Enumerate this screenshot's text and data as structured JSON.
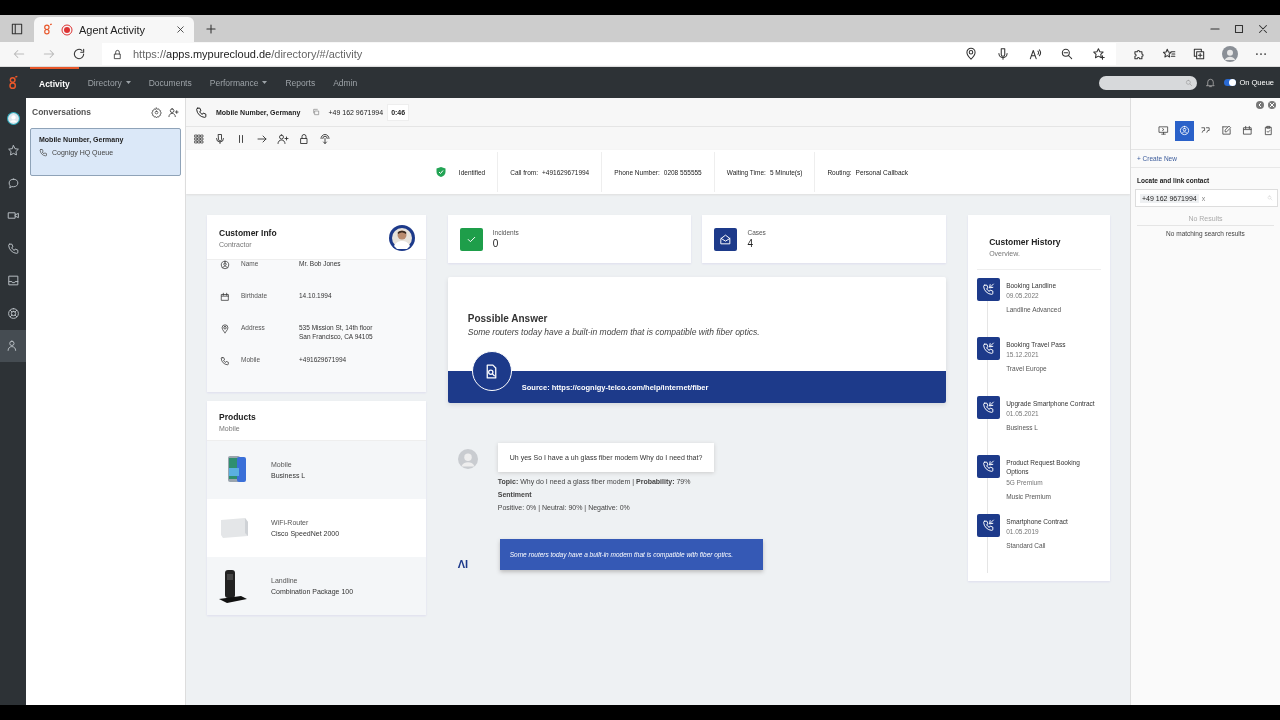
{
  "browser": {
    "tab_title": "Agent Activity",
    "url_scheme": "https://",
    "url_host": "apps.mypurecloud.de",
    "url_path": "/directory/#/activity"
  },
  "nav": {
    "items": [
      {
        "label": "Activity",
        "selected": true,
        "dropdown": false
      },
      {
        "label": "Directory",
        "selected": false,
        "dropdown": true
      },
      {
        "label": "Documents",
        "selected": false,
        "dropdown": false
      },
      {
        "label": "Performance",
        "selected": false,
        "dropdown": true
      },
      {
        "label": "Reports",
        "selected": false,
        "dropdown": false
      },
      {
        "label": "Admin",
        "selected": false,
        "dropdown": false
      }
    ],
    "status": {
      "label": "On Queue",
      "on": true
    }
  },
  "rail": [
    {
      "kind": "avatar",
      "selected": false
    },
    {
      "kind": "star",
      "selected": false
    },
    {
      "kind": "chat",
      "selected": false
    },
    {
      "kind": "video",
      "selected": false
    },
    {
      "kind": "phone",
      "selected": false
    },
    {
      "kind": "inbox",
      "selected": false
    },
    {
      "kind": "support",
      "selected": false
    },
    {
      "kind": "agents",
      "selected": true
    }
  ],
  "conversations": {
    "title": "Conversations",
    "items": [
      {
        "name": "Mobile Number, Germany",
        "queue": "Cognigy HQ Queue",
        "selected": true
      }
    ]
  },
  "call": {
    "name": "Mobile Number, Germany",
    "number": "+49 162 9671994",
    "timer": "0:46"
  },
  "info_strip": {
    "status": "Identified",
    "fields": [
      {
        "label": "Call from:",
        "value": "+491629671994"
      },
      {
        "label": "Phone Number:",
        "value": "0208 555555"
      },
      {
        "label": "Waiting Time:",
        "value": "5 Minute(s)"
      },
      {
        "label": "Routing:",
        "value": "Personal Callback"
      }
    ]
  },
  "customer_info": {
    "title": "Customer Info",
    "subtitle": "Contractor",
    "rows": [
      {
        "kind": "person",
        "label": "Name",
        "lines": [
          "Mr. Bob Jones"
        ]
      },
      {
        "kind": "calendar",
        "label": "Birthdate",
        "lines": [
          "14.10.1994"
        ]
      },
      {
        "kind": "location",
        "label": "Address",
        "lines": [
          "535 Mission St, 14th floor",
          "San Francisco, CA 94105"
        ]
      },
      {
        "kind": "phone",
        "label": "Mobile",
        "lines": [
          "+491629671994"
        ]
      }
    ]
  },
  "products": {
    "title": "Products",
    "subtitle": "Mobile",
    "items": [
      {
        "kind": "mobile",
        "name": "Mobile",
        "plan": "Business L"
      },
      {
        "kind": "router",
        "name": "WiFi-Router",
        "plan": "Cisco SpeedNet 2000"
      },
      {
        "kind": "landline",
        "name": "Landline",
        "plan": "Combination Package 100"
      }
    ]
  },
  "stats": [
    {
      "kind": "check",
      "label": "Incidents",
      "value": "0",
      "color": "#1e9e4a"
    },
    {
      "kind": "mail",
      "label": "Cases",
      "value": "4",
      "color": "#1d3a8a"
    }
  ],
  "answer": {
    "title": "Possible Answer",
    "text": "Some routers today have a built-in modem that is compatible with fiber optics.",
    "source": "Source: https://cognigy-telco.com/help/internet/fiber"
  },
  "transcript": {
    "customer_message": "Uh yes So I have a uh glass fiber modem Why do I need that?",
    "topic_line": "**Topic:** Why do I need a glass fiber modem | **Probability:** 79%",
    "sentiment_title": "Sentiment",
    "sentiment_line": "Positive: 0% | Neutral: 90% | Negative: 0%",
    "bot_label": "ΛI",
    "bot_message": "Some routers today have a built-in modem that is compatible with fiber optics."
  },
  "history": {
    "title": "Customer History",
    "subtitle": "Overview.",
    "items": [
      {
        "title": "Booking Landline",
        "lines": [
          "09.05.2022",
          "Landline Advanced"
        ]
      },
      {
        "title": "Booking Travel Pass",
        "lines": [
          "15.12.2021",
          "Travel Europe"
        ]
      },
      {
        "title": "Upgrade Smartphone Contract",
        "lines": [
          "01.05.2021",
          "Business L"
        ]
      },
      {
        "title": "Product Request Booking Options",
        "lines": [
          "5G Premium",
          "Music Premium"
        ]
      },
      {
        "title": "Smartphone Contract",
        "lines": [
          "01.05.2019",
          "Standard Call"
        ]
      }
    ]
  },
  "right_panel": {
    "tools": [
      {
        "kind": "screen",
        "selected": false
      },
      {
        "kind": "contact",
        "selected": true
      },
      {
        "kind": "quote",
        "selected": false
      },
      {
        "kind": "edit",
        "selected": false
      },
      {
        "kind": "calendar",
        "selected": false
      },
      {
        "kind": "clipboard",
        "selected": false
      }
    ],
    "create_new": "+ Create New",
    "locate_title": "Locate and link contact",
    "chip": "+49 162 9671994",
    "chip_remove": "x",
    "no_results": "No Results",
    "empty_message": "No matching search results"
  }
}
